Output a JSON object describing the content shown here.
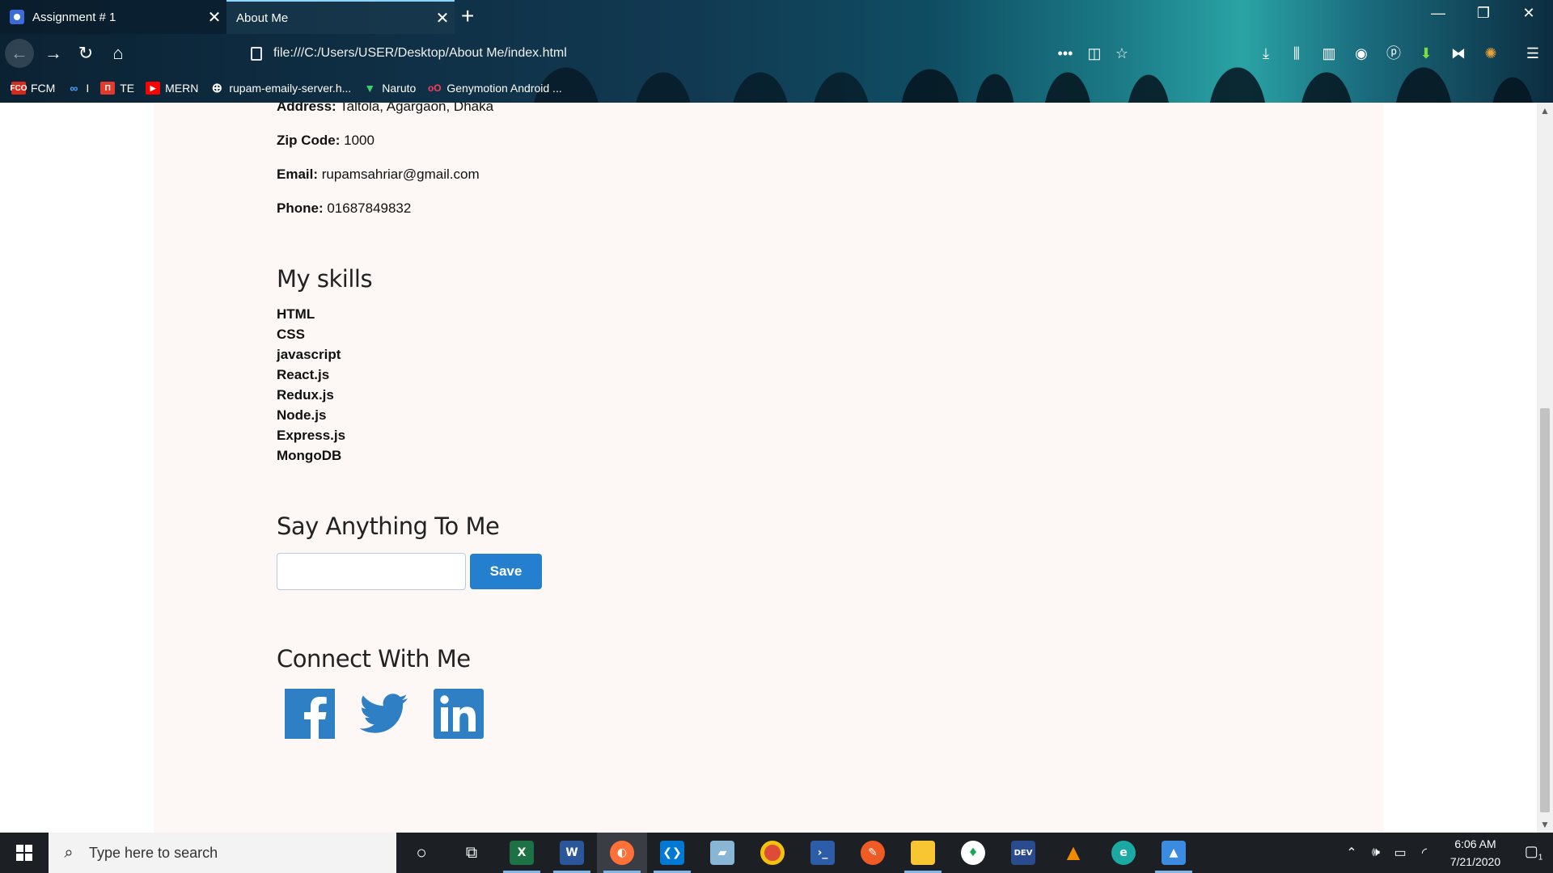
{
  "browser": {
    "tabs": [
      {
        "title": "Assignment # 1",
        "active": false
      },
      {
        "title": "About Me",
        "active": true
      }
    ],
    "url": "file:///C:/Users/USER/Desktop/About Me/index.html",
    "bookmarks": [
      {
        "label": "FCM",
        "icon": "fcm-icon"
      },
      {
        "label": "I",
        "icon": "infinity-icon"
      },
      {
        "label": "TE",
        "icon": "te-icon"
      },
      {
        "label": "MERN",
        "icon": "youtube-icon"
      },
      {
        "label": "rupam-emaily-server.h...",
        "icon": "globe-icon"
      },
      {
        "label": "Naruto",
        "icon": "tv-icon"
      },
      {
        "label": "Genymotion Android ...",
        "icon": "genymotion-icon"
      }
    ]
  },
  "page": {
    "address": {
      "label": "Address:",
      "value": "Taltola, Agargaon, Dhaka"
    },
    "zip": {
      "label": "Zip Code:",
      "value": "1000"
    },
    "email": {
      "label": "Email:",
      "value": "rupamsahriar@gmail.com"
    },
    "phone": {
      "label": "Phone:",
      "value": "01687849832"
    },
    "skills_title": "My skills",
    "skills": [
      "HTML",
      "CSS",
      "javascript",
      "React.js",
      "Redux.js",
      "Node.js",
      "Express.js",
      "MongoDB"
    ],
    "say_title": "Say Anything To Me",
    "message_input": {
      "value": "",
      "placeholder": ""
    },
    "save_label": "Save",
    "connect_title": "Connect With Me",
    "social": [
      "facebook-icon",
      "twitter-icon",
      "linkedin-icon"
    ],
    "social_color": "#2e7fc4"
  },
  "taskbar": {
    "search_placeholder": "Type here to search",
    "time": "6:06 AM",
    "date": "7/21/2020",
    "notification_count": "1"
  },
  "colors": {
    "accent": "#2480cf",
    "page_bg": "#fdf8f6"
  }
}
